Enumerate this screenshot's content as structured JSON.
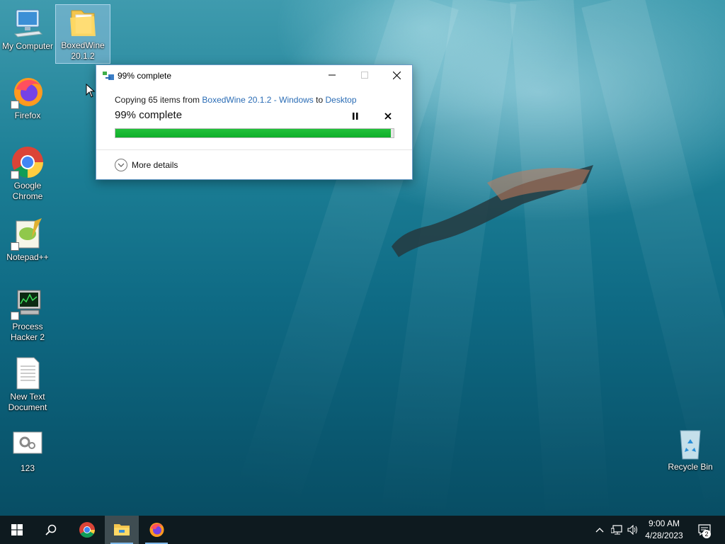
{
  "desktop": {
    "icons": [
      {
        "label": "My Computer",
        "icon": "computer-icon"
      },
      {
        "label": "BoxedWine 20.1.2",
        "icon": "folder-icon"
      },
      {
        "label": "Firefox",
        "icon": "firefox-icon"
      },
      {
        "label": "Google Chrome",
        "icon": "chrome-icon"
      },
      {
        "label": "Notepad++",
        "icon": "notepadpp-icon"
      },
      {
        "label": "Process Hacker 2",
        "icon": "process-hacker-icon"
      },
      {
        "label": "New Text Document",
        "icon": "text-document-icon"
      },
      {
        "label": "123",
        "icon": "settings-file-icon"
      },
      {
        "label": "Recycle Bin",
        "icon": "recycle-bin-icon"
      }
    ]
  },
  "dialog": {
    "title": "99% complete",
    "copy_prefix": "Copying 65 items from ",
    "source": "BoxedWine 20.1.2 - Windows",
    "to_word": " to ",
    "destination": "Desktop",
    "percent_label": "99% complete",
    "progress": 0.99,
    "more_details": "More details",
    "colors": {
      "progress": "#12b22e",
      "link": "#2a6cb5"
    }
  },
  "taskbar": {
    "items": [
      "start-icon",
      "search-icon",
      "chrome-icon",
      "file-explorer-icon",
      "firefox-icon"
    ],
    "clock": {
      "time": "9:00 AM",
      "date": "4/28/2023"
    },
    "notifications": "2"
  }
}
